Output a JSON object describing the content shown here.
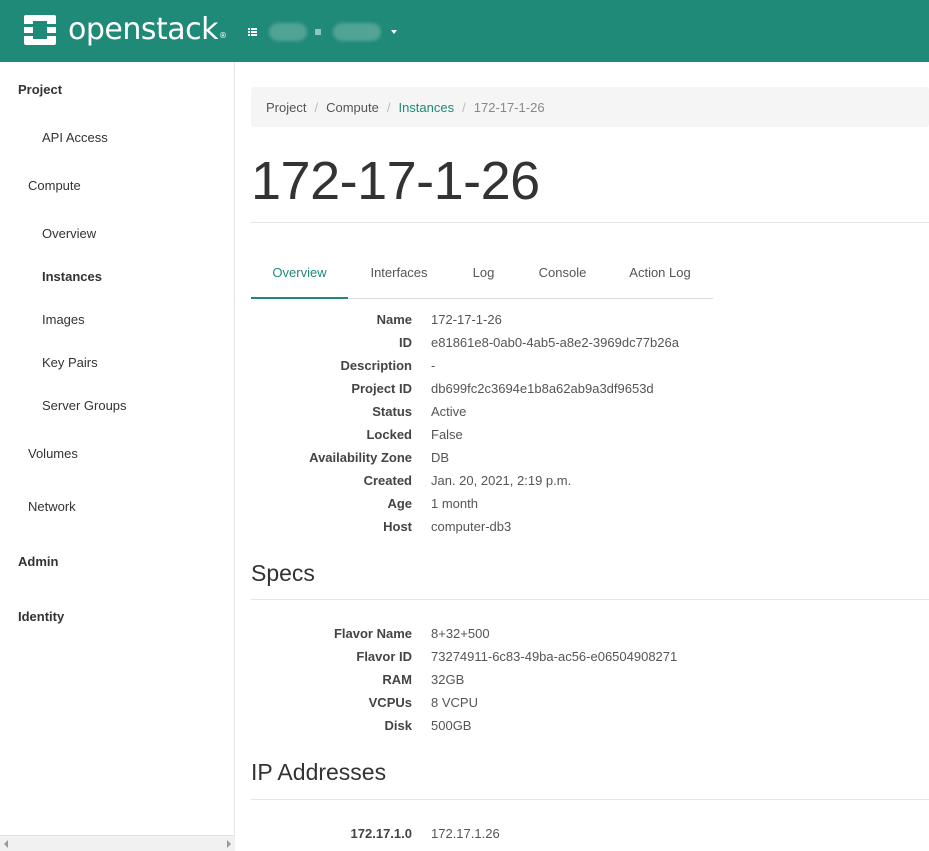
{
  "header": {
    "brand": "openstack",
    "trademark": "®",
    "logo_icon": "openstack-logo-icon",
    "project_switcher_icon": "list-icon"
  },
  "sidebar": {
    "items": [
      {
        "label": "Project",
        "level": 1
      },
      {
        "label": "API Access",
        "level": 3
      },
      {
        "label": "Compute",
        "level": 2
      },
      {
        "label": "Overview",
        "level": 3
      },
      {
        "label": "Instances",
        "level": 3,
        "active": true
      },
      {
        "label": "Images",
        "level": 3
      },
      {
        "label": "Key Pairs",
        "level": 3
      },
      {
        "label": "Server Groups",
        "level": 3
      },
      {
        "label": "Volumes",
        "level": 2
      },
      {
        "label": "Network",
        "level": 2
      },
      {
        "label": "Admin",
        "level": 1
      },
      {
        "label": "Identity",
        "level": 1
      }
    ]
  },
  "breadcrumb": {
    "items": [
      "Project",
      "Compute",
      "Instances",
      "172-17-1-26"
    ]
  },
  "page": {
    "title": "172-17-1-26"
  },
  "tabs": [
    "Overview",
    "Interfaces",
    "Log",
    "Console",
    "Action Log"
  ],
  "overview": [
    {
      "label": "Name",
      "value": "172-17-1-26"
    },
    {
      "label": "ID",
      "value": "e81861e8-0ab0-4ab5-a8e2-3969dc77b26a"
    },
    {
      "label": "Description",
      "value": "-"
    },
    {
      "label": "Project ID",
      "value": "db699fc2c3694e1b8a62ab9a3df9653d"
    },
    {
      "label": "Status",
      "value": "Active"
    },
    {
      "label": "Locked",
      "value": "False"
    },
    {
      "label": "Availability Zone",
      "value": "DB"
    },
    {
      "label": "Created",
      "value": "Jan. 20, 2021, 2:19 p.m."
    },
    {
      "label": "Age",
      "value": "1 month"
    },
    {
      "label": "Host",
      "value": "computer-db3"
    }
  ],
  "specs": {
    "title": "Specs",
    "rows": [
      {
        "label": "Flavor Name",
        "value": "8+32+500"
      },
      {
        "label": "Flavor ID",
        "value": "73274911-6c83-49ba-ac56-e06504908271"
      },
      {
        "label": "RAM",
        "value": "32GB"
      },
      {
        "label": "VCPUs",
        "value": "8 VCPU"
      },
      {
        "label": "Disk",
        "value": "500GB"
      }
    ]
  },
  "ip_addresses": {
    "title": "IP Addresses",
    "rows": [
      {
        "label": "172.17.1.0",
        "value": "172.17.1.26"
      }
    ]
  },
  "colors": {
    "brand": "#1f8a78",
    "link": "#1f8a78"
  }
}
